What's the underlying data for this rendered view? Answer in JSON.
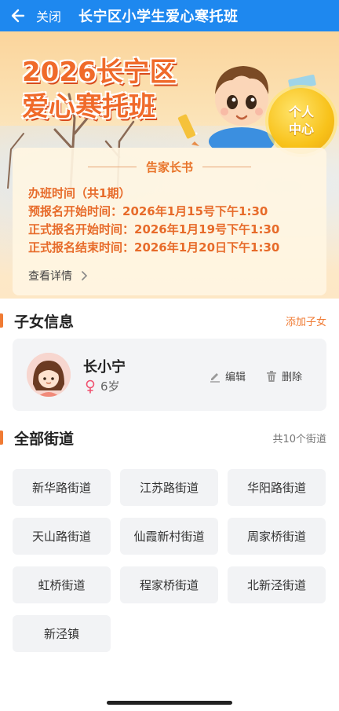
{
  "navbar": {
    "close_label": "关闭",
    "title": "长宁区小学生爱心寒托班"
  },
  "banner": {
    "title_line1": "2026长宁区",
    "title_line2": "爱心寒托班",
    "personal_center_line1": "个人",
    "personal_center_line2": "中心",
    "notice": {
      "heading": "告家长书",
      "lines": [
        "办班时间（共1期）",
        "预报名开始时间：2026年1月15号下午1:30",
        "正式报名开始时间：2026年1月19号下午1:30",
        "正式报名结束时间：2026年1月20日下午1:30"
      ],
      "more_label": "查看详情"
    }
  },
  "children": {
    "section_title": "子女信息",
    "add_label": "添加子女",
    "child": {
      "name": "长小宁",
      "age": "6岁"
    },
    "edit_label": "编辑",
    "delete_label": "删除"
  },
  "streets": {
    "section_title": "全部街道",
    "count_label": "共10个街道",
    "items": [
      "新华路街道",
      "江苏路街道",
      "华阳路街道",
      "天山路街道",
      "仙霞新村街道",
      "周家桥街道",
      "虹桥街道",
      "程家桥街道",
      "北新泾街道",
      "新泾镇"
    ]
  },
  "colors": {
    "nav_blue": "#1e88ef",
    "accent_orange": "#f07b34",
    "card_gray": "#f3f4f6"
  }
}
